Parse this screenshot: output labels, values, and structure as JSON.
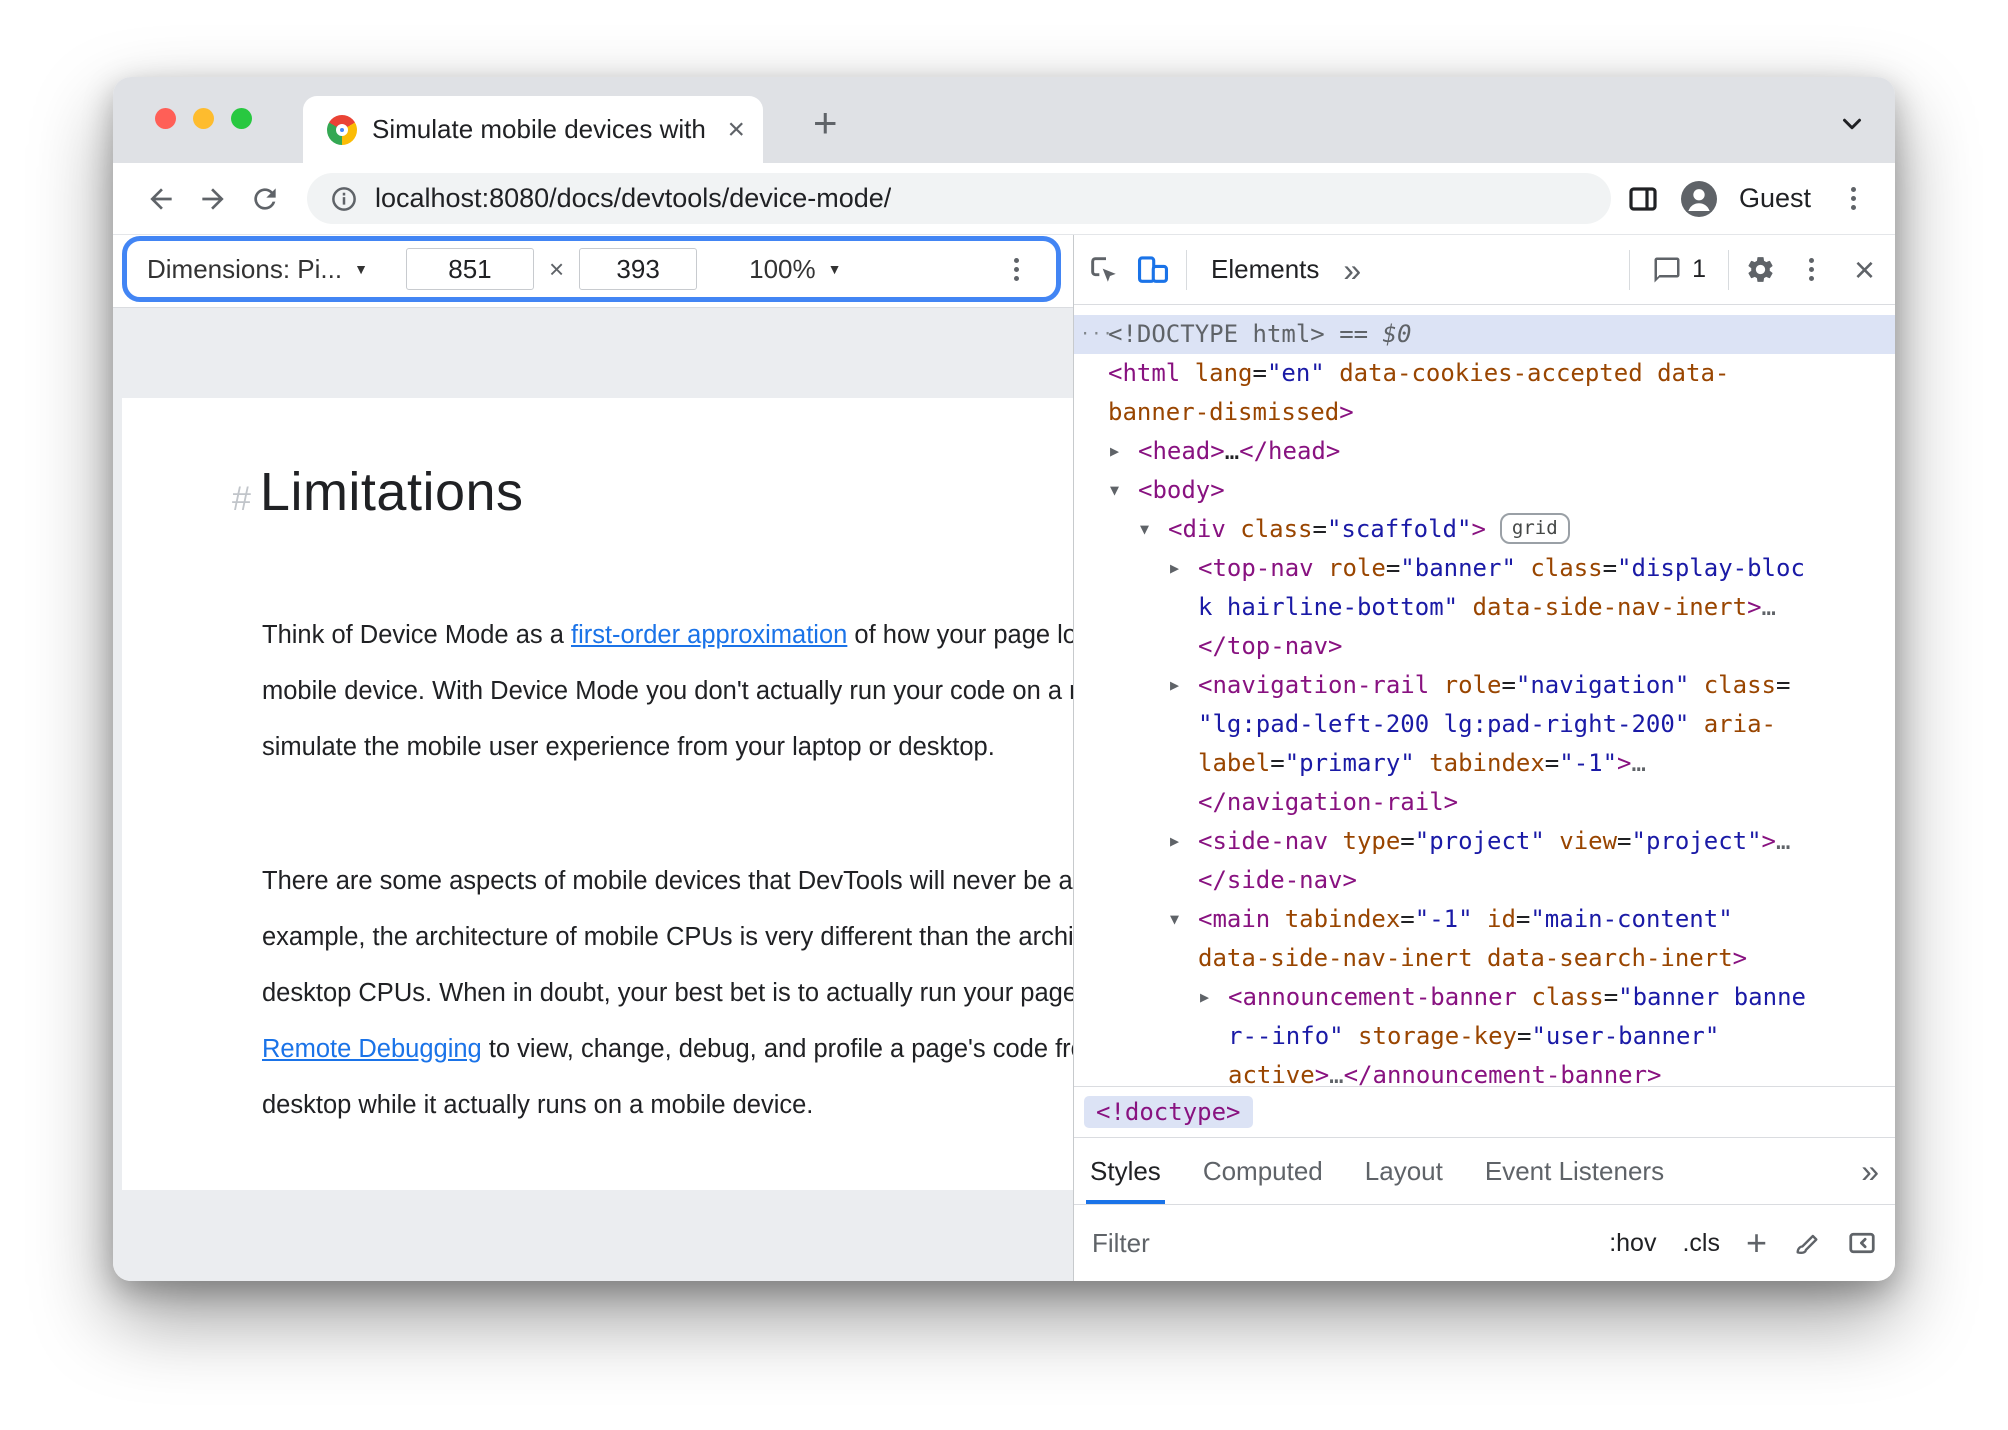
{
  "colors": {
    "accent": "#1a73e8",
    "focus": "#4285f4",
    "link": "#1a73e8",
    "tag": "#881280",
    "attr": "#994500",
    "val": "#1a1aa6",
    "selrow": "#dce3f5",
    "mac_close": "#ff5f57",
    "mac_min": "#febc2e",
    "mac_max": "#28c840"
  },
  "icons": {
    "dropdown_arrow": "▼",
    "collapsed_arrow": "▶",
    "expanded_arrow": "▼",
    "more_chevrons": "»",
    "plus": "+",
    "close": "×",
    "node_ellipsis": "···"
  },
  "window": {
    "tab_title": "Simulate mobile devices with D",
    "url": "localhost:8080/docs/devtools/device-mode/",
    "profile_label": "Guest"
  },
  "device_toolbar": {
    "dimensions_label": "Dimensions: Pi...",
    "width_value": "851",
    "times": "×",
    "height_value": "393",
    "zoom_value": "100%"
  },
  "page": {
    "heading_hash": "#",
    "heading": "Limitations",
    "paragraphs": [
      {
        "lines": [
          [
            {
              "t": "Think of Device Mode as a "
            },
            {
              "t": "first-order approximation",
              "link": true
            },
            {
              "t": " of how your page looks and feels on a"
            }
          ],
          [
            {
              "t": "mobile device. With Device Mode you don't actually run your code on a mobile device. You"
            }
          ],
          [
            {
              "t": "simulate the mobile user experience from your laptop or desktop."
            }
          ]
        ]
      },
      {
        "lines": [
          [
            {
              "t": "There are some aspects of mobile devices that DevTools will never be able to simulate. For"
            }
          ],
          [
            {
              "t": "example, the architecture of mobile CPUs is very different than the architecture of laptop or"
            }
          ],
          [
            {
              "t": "desktop CPUs. When in doubt, your best bet is to actually run your page on a mobile device. Use"
            }
          ],
          [
            {
              "t": "Remote Debugging",
              "link": true
            },
            {
              "t": " to view, change, debug, and profile a page's code from your laptop or"
            }
          ],
          [
            {
              "t": "desktop while it actually runs on a mobile device."
            }
          ]
        ]
      }
    ]
  },
  "devtools": {
    "elements_tab": "Elements",
    "issues_count": "1",
    "breadcrumb": "<!doctype>",
    "panes": [
      "Styles",
      "Computed",
      "Layout",
      "Event Listeners"
    ],
    "hov": ":hov",
    "cls": ".cls",
    "filter_placeholder": "Filter",
    "dom_lines": [
      {
        "indent": 0,
        "marker": "dots",
        "selected": true,
        "tokens": [
          {
            "c": "gray",
            "t": "<!DOCTYPE html>"
          },
          {
            "c": "grayit",
            "t": " == $0"
          }
        ]
      },
      {
        "indent": 0,
        "tokens": [
          {
            "c": "tag",
            "t": "<html"
          },
          {
            "c": "plain",
            "t": " "
          },
          {
            "c": "attr",
            "t": "lang"
          },
          {
            "c": "plain",
            "t": "="
          },
          {
            "c": "val",
            "t": "\"en\""
          },
          {
            "c": "plain",
            "t": " "
          },
          {
            "c": "attr",
            "t": "data-cookies-accepted"
          },
          {
            "c": "plain",
            "t": " "
          },
          {
            "c": "attr",
            "t": "data-"
          }
        ]
      },
      {
        "indent": 0,
        "tokens": [
          {
            "c": "attr",
            "t": "banner-dismissed"
          },
          {
            "c": "tag",
            "t": ">"
          }
        ]
      },
      {
        "indent": 1,
        "marker": "collapsed",
        "tokens": [
          {
            "c": "tag",
            "t": "<head>"
          },
          {
            "c": "plain",
            "t": "…"
          },
          {
            "c": "tag",
            "t": "</head>"
          }
        ]
      },
      {
        "indent": 1,
        "marker": "expanded",
        "tokens": [
          {
            "c": "tag",
            "t": "<body>"
          }
        ]
      },
      {
        "indent": 2,
        "marker": "expanded",
        "badge": "grid",
        "tokens": [
          {
            "c": "tag",
            "t": "<div"
          },
          {
            "c": "plain",
            "t": " "
          },
          {
            "c": "attr",
            "t": "class"
          },
          {
            "c": "plain",
            "t": "="
          },
          {
            "c": "val",
            "t": "\"scaffold\""
          },
          {
            "c": "tag",
            "t": ">"
          }
        ]
      },
      {
        "indent": 3,
        "marker": "collapsed",
        "tokens": [
          {
            "c": "tag",
            "t": "<top-nav"
          },
          {
            "c": "plain",
            "t": " "
          },
          {
            "c": "attr",
            "t": "role"
          },
          {
            "c": "plain",
            "t": "="
          },
          {
            "c": "val",
            "t": "\"banner\""
          },
          {
            "c": "plain",
            "t": " "
          },
          {
            "c": "attr",
            "t": "class"
          },
          {
            "c": "plain",
            "t": "="
          },
          {
            "c": "val",
            "t": "\"display-bloc"
          }
        ]
      },
      {
        "indent": 3,
        "tokens": [
          {
            "c": "val",
            "t": "k hairline-bottom\""
          },
          {
            "c": "plain",
            "t": " "
          },
          {
            "c": "attr",
            "t": "data-side-nav-inert"
          },
          {
            "c": "tag",
            "t": ">"
          },
          {
            "c": "gray",
            "t": "…"
          }
        ]
      },
      {
        "indent": 3,
        "tokens": [
          {
            "c": "tag",
            "t": "</top-nav>"
          }
        ]
      },
      {
        "indent": 3,
        "marker": "collapsed",
        "tokens": [
          {
            "c": "tag",
            "t": "<navigation-rail"
          },
          {
            "c": "plain",
            "t": " "
          },
          {
            "c": "attr",
            "t": "role"
          },
          {
            "c": "plain",
            "t": "="
          },
          {
            "c": "val",
            "t": "\"navigation\""
          },
          {
            "c": "plain",
            "t": " "
          },
          {
            "c": "attr",
            "t": "class"
          },
          {
            "c": "plain",
            "t": "="
          }
        ]
      },
      {
        "indent": 3,
        "tokens": [
          {
            "c": "val",
            "t": "\"lg:pad-left-200 lg:pad-right-200\""
          },
          {
            "c": "plain",
            "t": " "
          },
          {
            "c": "attr",
            "t": "aria-"
          }
        ]
      },
      {
        "indent": 3,
        "tokens": [
          {
            "c": "attr",
            "t": "label"
          },
          {
            "c": "plain",
            "t": "="
          },
          {
            "c": "val",
            "t": "\"primary\""
          },
          {
            "c": "plain",
            "t": " "
          },
          {
            "c": "attr",
            "t": "tabindex"
          },
          {
            "c": "plain",
            "t": "="
          },
          {
            "c": "val",
            "t": "\"-1\""
          },
          {
            "c": "tag",
            "t": ">"
          },
          {
            "c": "gray",
            "t": "…"
          }
        ]
      },
      {
        "indent": 3,
        "tokens": [
          {
            "c": "tag",
            "t": "</navigation-rail>"
          }
        ]
      },
      {
        "indent": 3,
        "marker": "collapsed",
        "tokens": [
          {
            "c": "tag",
            "t": "<side-nav"
          },
          {
            "c": "plain",
            "t": " "
          },
          {
            "c": "attr",
            "t": "type"
          },
          {
            "c": "plain",
            "t": "="
          },
          {
            "c": "val",
            "t": "\"project\""
          },
          {
            "c": "plain",
            "t": " "
          },
          {
            "c": "attr",
            "t": "view"
          },
          {
            "c": "plain",
            "t": "="
          },
          {
            "c": "val",
            "t": "\"project\""
          },
          {
            "c": "tag",
            "t": ">"
          },
          {
            "c": "gray",
            "t": "…"
          }
        ]
      },
      {
        "indent": 3,
        "tokens": [
          {
            "c": "tag",
            "t": "</side-nav>"
          }
        ]
      },
      {
        "indent": 3,
        "marker": "expanded",
        "tokens": [
          {
            "c": "tag",
            "t": "<main"
          },
          {
            "c": "plain",
            "t": " "
          },
          {
            "c": "attr",
            "t": "tabindex"
          },
          {
            "c": "plain",
            "t": "="
          },
          {
            "c": "val",
            "t": "\"-1\""
          },
          {
            "c": "plain",
            "t": " "
          },
          {
            "c": "attr",
            "t": "id"
          },
          {
            "c": "plain",
            "t": "="
          },
          {
            "c": "val",
            "t": "\"main-content\""
          }
        ]
      },
      {
        "indent": 3,
        "tokens": [
          {
            "c": "attr",
            "t": "data-side-nav-inert"
          },
          {
            "c": "plain",
            "t": " "
          },
          {
            "c": "attr",
            "t": "data-search-inert"
          },
          {
            "c": "tag",
            "t": ">"
          }
        ]
      },
      {
        "indent": 4,
        "marker": "collapsed",
        "tokens": [
          {
            "c": "tag",
            "t": "<announcement-banner"
          },
          {
            "c": "plain",
            "t": " "
          },
          {
            "c": "attr",
            "t": "class"
          },
          {
            "c": "plain",
            "t": "="
          },
          {
            "c": "val",
            "t": "\"banner banne"
          }
        ]
      },
      {
        "indent": 4,
        "tokens": [
          {
            "c": "val",
            "t": "r--info\""
          },
          {
            "c": "plain",
            "t": " "
          },
          {
            "c": "attr",
            "t": "storage-key"
          },
          {
            "c": "plain",
            "t": "="
          },
          {
            "c": "val",
            "t": "\"user-banner\""
          }
        ]
      },
      {
        "indent": 4,
        "tokens": [
          {
            "c": "attr",
            "t": "active"
          },
          {
            "c": "tag",
            "t": ">"
          },
          {
            "c": "gray",
            "t": "…"
          },
          {
            "c": "tag",
            "t": "</announcement-banner>"
          }
        ]
      }
    ]
  }
}
